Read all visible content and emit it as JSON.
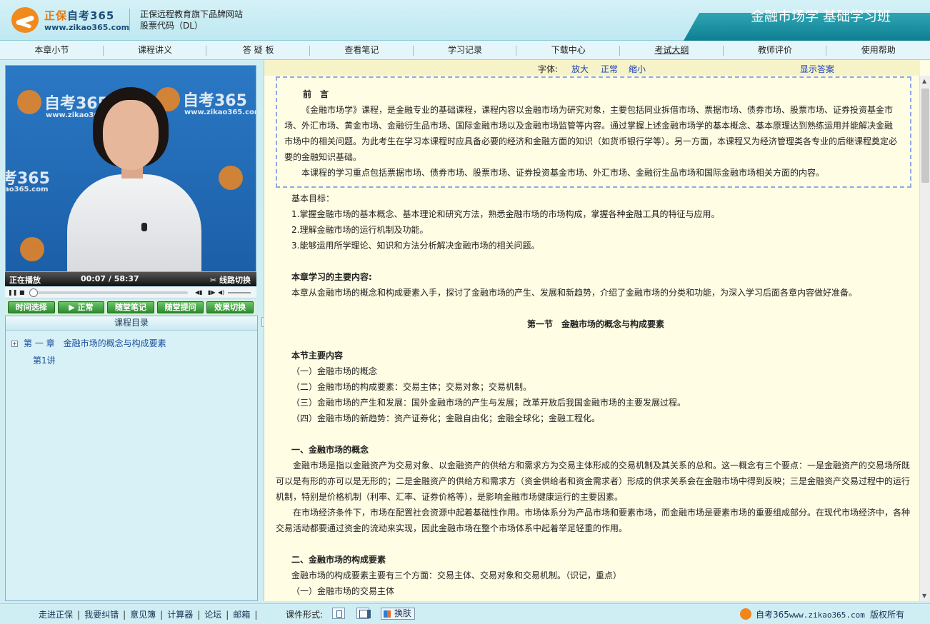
{
  "header": {
    "logo_name_a": "正保",
    "logo_name_b": "自考365",
    "logo_url": "www.zikao365.com",
    "slogan_line1": "正保远程教育旗下品牌网站",
    "slogan_line2": "股票代码（DL）",
    "course_title": "金融市场学 基础学习班"
  },
  "nav": [
    "本章小节",
    "课程讲义",
    "答 疑 板",
    "查看笔记",
    "学习记录",
    "下载中心",
    "考试大纲",
    "教师评价",
    "使用帮助"
  ],
  "player": {
    "watermark_text": "自考365",
    "watermark_url": "www.zikao365.com",
    "watermark_partial_left": "考365",
    "watermark_partial_left_url": "ao365.com",
    "status": "正在播放",
    "time": "00:07 / 58:37",
    "switch_line": "线路切换",
    "buttons": [
      "时间选择",
      "▶ 正常",
      "随堂笔记",
      "随堂提问",
      "效果切换"
    ]
  },
  "catalog": {
    "title": "课程目录",
    "chapter": "第 一 章　金融市场的概念与构成要素",
    "lecture": "第1讲"
  },
  "font_bar": {
    "label": "字体:",
    "enlarge": "放大",
    "normal": "正常",
    "shrink": "缩小",
    "show_answer": "显示答案"
  },
  "content": {
    "preface_title": "前　言",
    "preface_p1": "《金融市场学》课程，是金融专业的基础课程，课程内容以金融市场为研究对象，主要包括同业拆借市场、票据市场、债券市场、股票市场、证券投资基金市场、外汇市场、黄金市场、金融衍生品市场、国际金融市场以及金融市场监管等内容。通过掌握上述金融市场学的基本概念、基本原理达到熟练运用并能解决金融市场中的相关问题。为此考生在学习本课程时应具备必要的经济和金融方面的知识（如货币银行学等）。另一方面，本课程又为经济管理类各专业的后继课程奠定必要的金融知识基础。",
    "preface_p2": "本课程的学习重点包括票据市场、债券市场、股票市场、证券投资基金市场、外汇市场、金融衍生品市场和国际金融市场相关方面的内容。",
    "goal_title": "基本目标：",
    "goals": [
      "1.掌握金融市场的基本概念、基本理论和研究方法，熟悉金融市场的市场构成，掌握各种金融工具的特征与应用。",
      "2.理解金融市场的运行机制及功能。",
      "3.能够运用所学理论、知识和方法分析解决金融市场的相关问题。"
    ],
    "main_title": "本章学习的主要内容:",
    "main_text": "本章从金融市场的概念和构成要素入手，探讨了金融市场的产生、发展和新趋势，介绍了金融市场的分类和功能，为深入学习后面各章内容做好准备。",
    "section_title": "第一节　金融市场的概念与构成要素",
    "section_main_title": "本节主要内容",
    "section_items": [
      "（一）金融市场的概念",
      "（二）金融市场的构成要素：交易主体；交易对象；交易机制。",
      "（三）金融市场的产生和发展：国外金融市场的产生与发展；改革开放后我国金融市场的主要发展过程。",
      "（四）金融市场的新趋势：资产证券化；金融自由化；金融全球化；金融工程化。"
    ],
    "concept_title": "一、金融市场的概念",
    "concept_p1": "金融市场是指以金融资产为交易对象、以金融资产的供给方和需求方为交易主体形成的交易机制及其关系的总和。这一概念有三个要点：一是金融资产的交易场所既可以是有形的亦可以是无形的；二是金融资产的供给方和需求方（资金供给者和资金需求者）形成的供求关系会在金融市场中得到反映；三是金融资产交易过程中的运行机制，特别是价格机制（利率、汇率、证券价格等），是影响金融市场健康运行的主要因素。",
    "concept_p2": "在市场经济条件下，市场在配置社会资源中起着基础性作用。市场体系分为产品市场和要素市场，而金融市场是要素市场的重要组成部分。在现代市场经济中，各种交易活动都要通过资金的流动来实现，因此金融市场在整个市场体系中起着举足轻重的作用。",
    "element_title": "二、金融市场的构成要素",
    "element_text": "金融市场的构成要素主要有三个方面：交易主体、交易对象和交易机制。（识记，重点）",
    "element_partial": "（一）金融市场的交易主体"
  },
  "footer": {
    "links": [
      "走进正保",
      "我要纠错",
      "意见簿",
      "计算器",
      "论坛",
      "邮箱"
    ],
    "form_label": "课件形式:",
    "skin": "换肤",
    "site_label": "自考365",
    "site_url": "www.zikao365.com",
    "copyright": "版权所有"
  },
  "colors": {
    "banner": "#0e7f92",
    "content_bg": "#fffde4",
    "link_blue": "#1c3fb4",
    "button_green": "#2d8c2f",
    "brand_orange": "#ef8620"
  }
}
